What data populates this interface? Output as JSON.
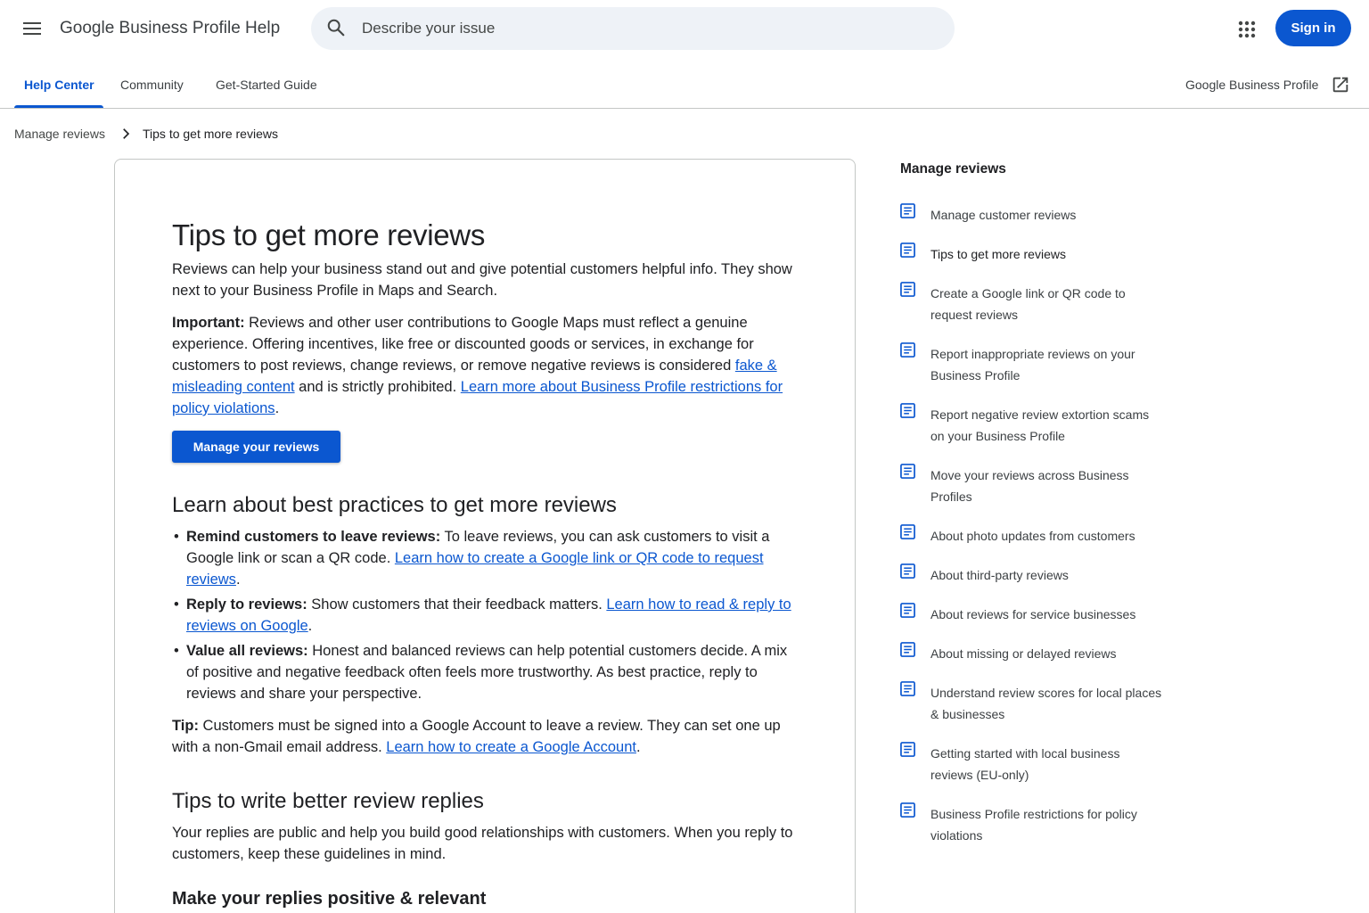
{
  "header": {
    "title": "Google Business Profile Help",
    "search_placeholder": "Describe your issue",
    "signin_label": "Sign in"
  },
  "tabs": [
    {
      "label": "Help Center",
      "active": true
    },
    {
      "label": "Community"
    },
    {
      "label": "Get-Started Guide"
    }
  ],
  "external_link": "Google Business Profile",
  "breadcrumb": [
    "Manage reviews",
    "Tips to get more reviews"
  ],
  "article": {
    "title": "Tips to get more reviews",
    "intro": "Reviews can help your business stand out and give potential customers helpful info. They show next to your Business Profile in Maps and Search.",
    "important_label": "Important:",
    "important_text": " Reviews and other user contributions to Google Maps must reflect a genuine experience. Offering incentives, like free or discounted goods or services, in exchange for customers to post reviews, change reviews, or remove negative reviews is considered ",
    "important_link1": "fake & misleading content",
    "important_mid": " and is strictly prohibited. ",
    "important_link2": "Learn more about Business Profile restrictions for policy violations",
    "important_end": ".",
    "manage_button": "Manage your reviews",
    "section1_title": "Learn about best practices to get more reviews",
    "bullets": [
      {
        "label": "Remind customers to leave reviews:",
        "text": " To leave reviews, you can ask customers to visit a Google link or scan a QR code. ",
        "link": "Learn how to create a Google link or QR code to request reviews",
        "end": "."
      },
      {
        "label": "Reply to reviews:",
        "text": " Show customers that their feedback matters. ",
        "link": "Learn how to read & reply to reviews on Google",
        "end": "."
      },
      {
        "label": "Value all reviews:",
        "text": " Honest and balanced reviews can help potential customers decide. A mix of positive and negative feedback often feels more trustworthy. As best practice, reply to reviews and share your perspective.",
        "link": "",
        "end": ""
      }
    ],
    "tip_label": "Tip:",
    "tip_text": " Customers must be signed into a Google Account to leave a review. They can set one up with a non-Gmail email address. ",
    "tip_link": "Learn how to create a Google Account",
    "tip_end": ".",
    "section2_title": "Tips to write better review replies",
    "section2_text": "Your replies are public and help you build good relationships with customers. When you reply to customers, keep these guidelines in mind.",
    "subsection_title": "Make your replies positive & relevant"
  },
  "sidebar": {
    "title": "Manage reviews",
    "items": [
      "Manage customer reviews",
      "Tips to get more reviews",
      "Create a Google link or QR code to request reviews",
      "Report inappropriate reviews on your Business Profile",
      "Report negative review extortion scams on your Business Profile",
      "Move your reviews across Business Profiles",
      "About photo updates from customers",
      "About third-party reviews",
      "About reviews for service businesses",
      "About missing or delayed reviews",
      "Understand review scores for local places & businesses",
      "Getting started with local business reviews (EU-only)",
      "Business Profile restrictions for policy violations"
    ],
    "current_index": 1
  },
  "colors": {
    "accent": "#0b57d0",
    "search_bg": "#eef2f7",
    "border": "#c4c7c5"
  }
}
